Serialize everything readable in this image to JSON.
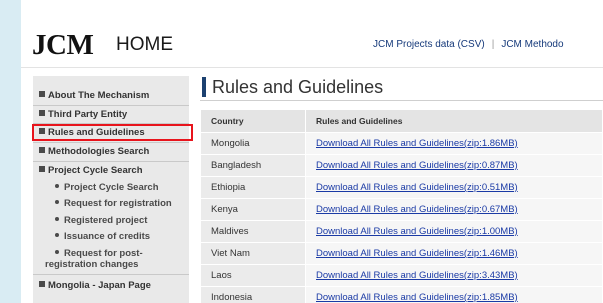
{
  "header": {
    "logo": "JCM",
    "home_label": "HOME",
    "links": [
      "JCM Projects data (CSV)",
      "JCM Methodo"
    ],
    "separator": "|"
  },
  "sidebar": {
    "items": [
      {
        "label": "About The Mechanism"
      },
      {
        "label": "Third Party Entity"
      },
      {
        "label": "Rules and Guidelines",
        "highlighted": true
      },
      {
        "label": "Methodologies Search"
      },
      {
        "label": "Project Cycle Search"
      },
      {
        "label": "Mongolia - Japan Page"
      }
    ],
    "sub_items": [
      {
        "label": "Project Cycle Search"
      },
      {
        "label": "Request for registration"
      },
      {
        "label": "Registered project"
      },
      {
        "label": "Issuance of credits"
      },
      {
        "label": "Request for post-",
        "label2": "registration changes"
      }
    ]
  },
  "main": {
    "title": "Rules and Guidelines",
    "table": {
      "headers": [
        "Country",
        "Rules and Guidelines"
      ],
      "rows": [
        {
          "country": "Mongolia",
          "link": "Download All Rules and Guidelines(zip:1.86MB)"
        },
        {
          "country": "Bangladesh",
          "link": "Download All Rules and Guidelines(zip:0.87MB)"
        },
        {
          "country": "Ethiopia",
          "link": "Download All Rules and Guidelines(zip:0.51MB)"
        },
        {
          "country": "Kenya",
          "link": "Download All Rules and Guidelines(zip:0.67MB)"
        },
        {
          "country": "Maldives",
          "link": "Download All Rules and Guidelines(zip:1.00MB)"
        },
        {
          "country": "Viet Nam",
          "link": "Download All Rules and Guidelines(zip:1.46MB)"
        },
        {
          "country": "Laos",
          "link": "Download All Rules and Guidelines(zip:3.43MB)"
        },
        {
          "country": "Indonesia",
          "link": "Download All Rules and Guidelines(zip:1.85MB)"
        }
      ]
    }
  },
  "colors": {
    "page_background": "#d9ecf3",
    "title_accent": "#1c4170",
    "link": "#1a3aa5",
    "highlight_box": "#e8141c"
  }
}
